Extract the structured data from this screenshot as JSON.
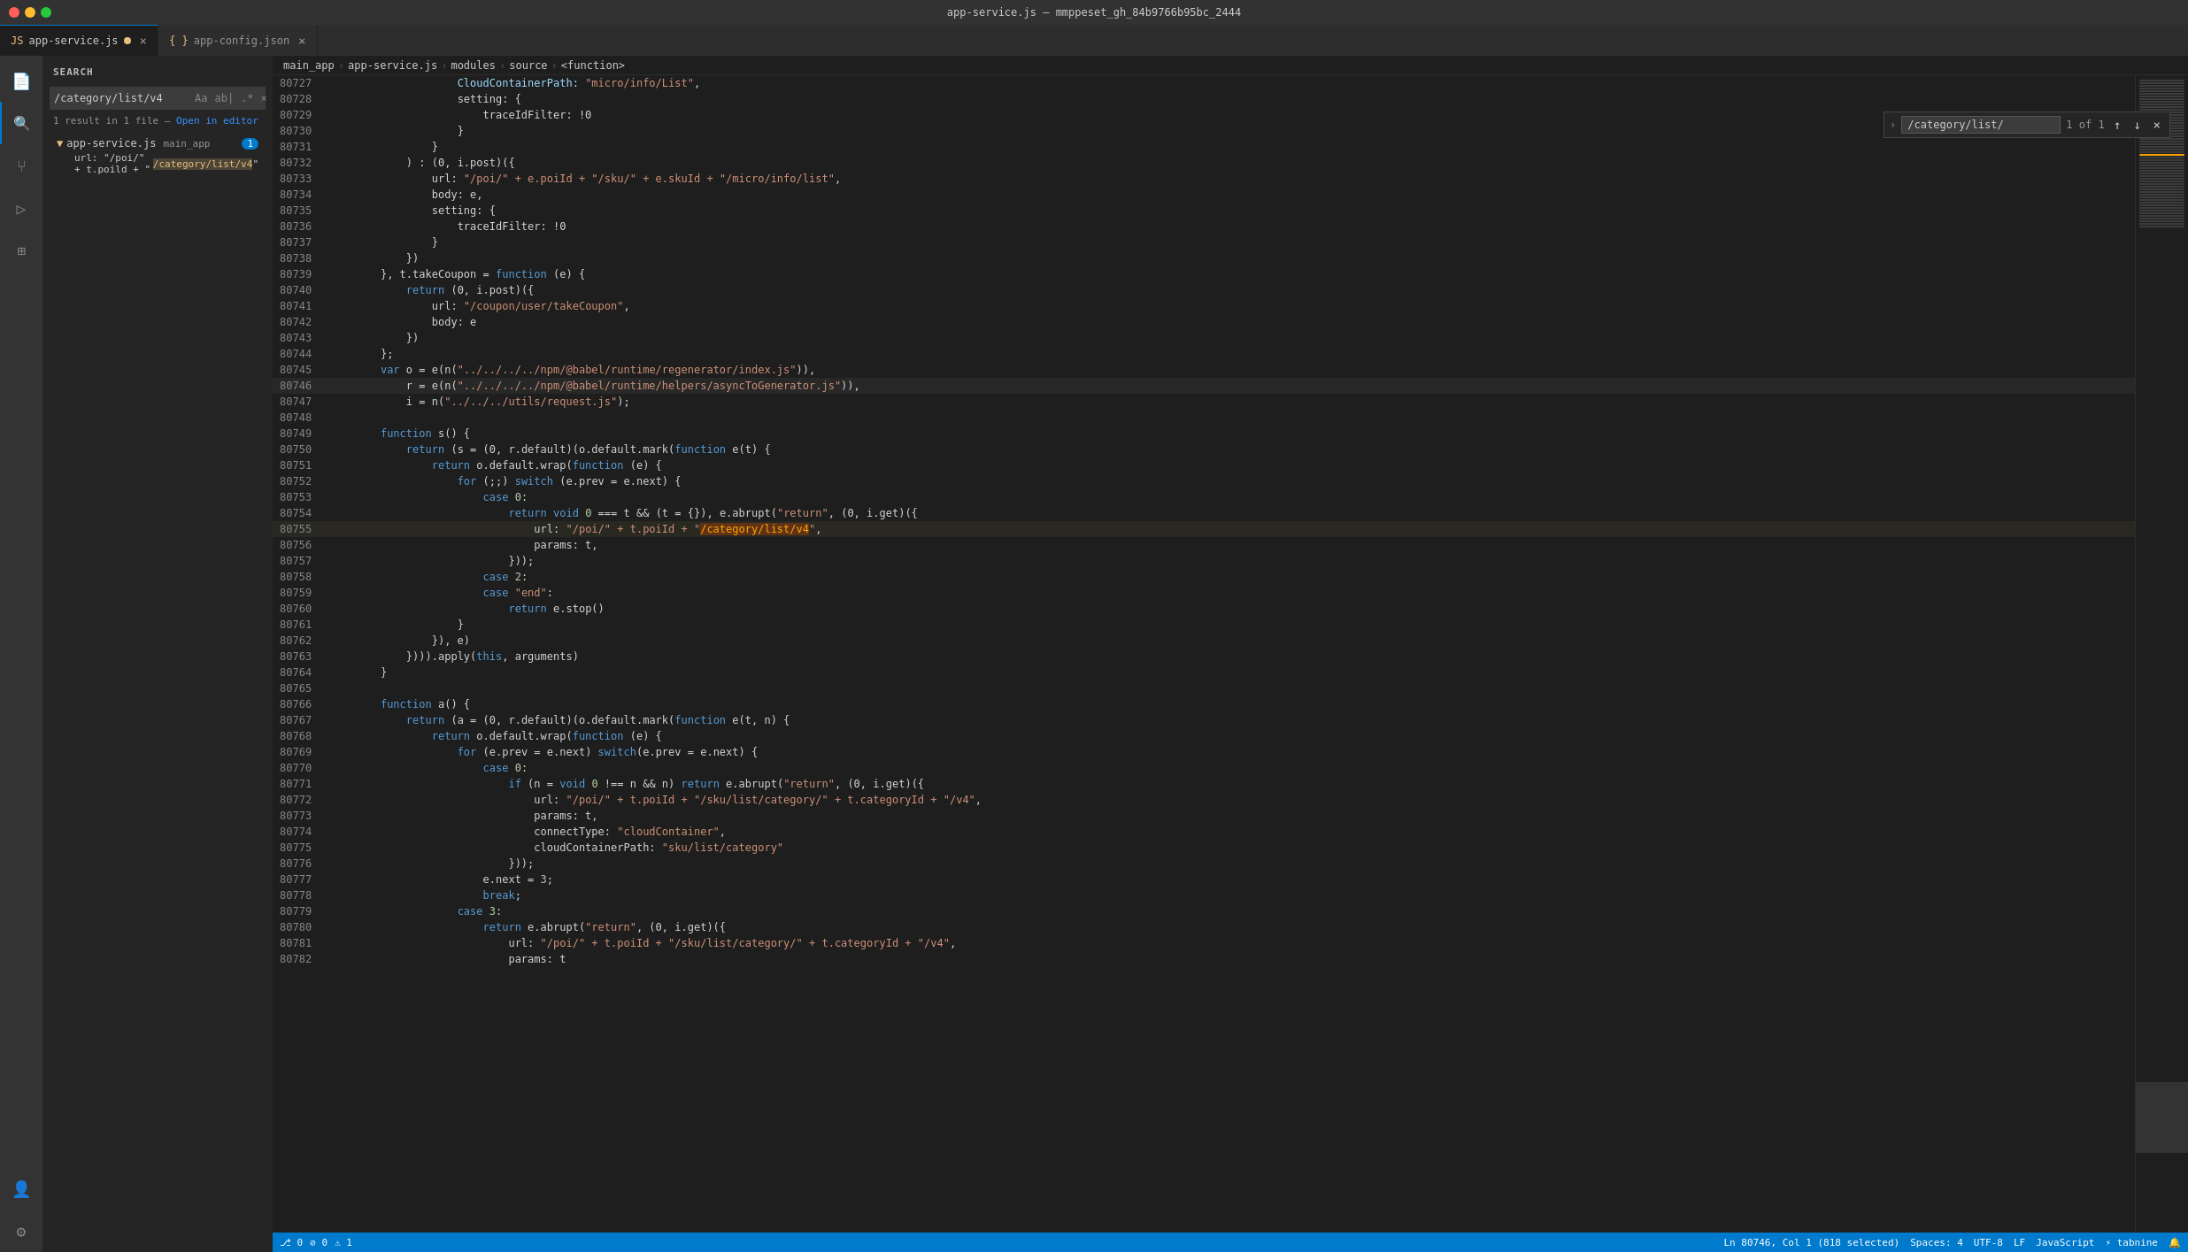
{
  "window": {
    "title": "app-service.js — mmppeset_gh_84b9766b95bc_2444"
  },
  "tabs": [
    {
      "id": "tab-app-service",
      "label": "app-service.js",
      "modified": true,
      "active": true,
      "icon": "js-icon"
    },
    {
      "id": "tab-app-config",
      "label": "app-config.json",
      "modified": false,
      "active": false,
      "icon": "json-icon"
    }
  ],
  "breadcrumb": {
    "items": [
      "main_app",
      "app-service.js",
      "modules",
      "source",
      "<function>"
    ]
  },
  "search": {
    "title": "SEARCH",
    "query": "/category/list/v4",
    "results_text": "1 result in 1 file",
    "open_in_editor": "Open in editor",
    "file": {
      "name": "app-service.js",
      "path": "main_app",
      "count": 1,
      "match_prefix": "url: \"/poi/\" + t.poild + \"",
      "match_text": "/category/list/v4",
      "match_suffix": "\""
    }
  },
  "find_widget": {
    "query": "/category/list/",
    "count": "1 of 1",
    "placeholder": ""
  },
  "code": {
    "lines": [
      {
        "num": "80727",
        "tokens": [
          {
            "t": "                    "
          },
          {
            "t": "CloudContainerPath: ",
            "c": "prop"
          },
          {
            "t": "\"micro/info/List\"",
            "c": "str"
          },
          {
            "t": ","
          }
        ]
      },
      {
        "num": "80728",
        "tokens": [
          {
            "t": "                    "
          },
          {
            "t": "setting"
          },
          {
            "t": ": {"
          }
        ]
      },
      {
        "num": "80729",
        "tokens": [
          {
            "t": "                        "
          },
          {
            "t": "traceIdFilter"
          },
          {
            "t": ": "
          },
          {
            "t": "!0"
          }
        ]
      },
      {
        "num": "80730",
        "tokens": [
          {
            "t": "                    "
          },
          {
            "t": "}"
          }
        ]
      },
      {
        "num": "80731",
        "tokens": [
          {
            "t": "                "
          },
          {
            "t": "}"
          }
        ]
      },
      {
        "num": "80732",
        "tokens": [
          {
            "t": "            "
          },
          {
            "t": ") : (0, i.post)({"
          }
        ]
      },
      {
        "num": "80733",
        "tokens": [
          {
            "t": "                "
          },
          {
            "t": "url"
          },
          {
            "t": ": "
          },
          {
            "t": "\"/poi/\" + e.poiId + \"/sku/\" + e.skuId + \"/micro/info/list\"",
            "c": "str"
          },
          {
            "t": ","
          }
        ]
      },
      {
        "num": "80734",
        "tokens": [
          {
            "t": "                "
          },
          {
            "t": "body"
          },
          {
            "t": ": e,"
          }
        ]
      },
      {
        "num": "80735",
        "tokens": [
          {
            "t": "                "
          },
          {
            "t": "setting"
          },
          {
            "t": ": {"
          }
        ]
      },
      {
        "num": "80736",
        "tokens": [
          {
            "t": "                    "
          },
          {
            "t": "traceIdFilter"
          },
          {
            "t": ": "
          },
          {
            "t": "!0"
          }
        ]
      },
      {
        "num": "80737",
        "tokens": [
          {
            "t": "                "
          },
          {
            "t": "}"
          }
        ]
      },
      {
        "num": "80738",
        "tokens": [
          {
            "t": "            "
          },
          {
            "t": "})"
          }
        ]
      },
      {
        "num": "80739",
        "tokens": [
          {
            "t": "        "
          },
          {
            "t": "}, t.takeCoupon = "
          },
          {
            "t": "function",
            "c": "kw"
          },
          {
            "t": " (e) {"
          }
        ]
      },
      {
        "num": "80740",
        "tokens": [
          {
            "t": "            "
          },
          {
            "t": "return",
            "c": "kw"
          },
          {
            "t": " (0, i.post)({"
          }
        ]
      },
      {
        "num": "80741",
        "tokens": [
          {
            "t": "                "
          },
          {
            "t": "url"
          },
          {
            "t": ": "
          },
          {
            "t": "\"/coupon/user/takeCoupon\"",
            "c": "str"
          },
          {
            "t": ","
          }
        ]
      },
      {
        "num": "80742",
        "tokens": [
          {
            "t": "                "
          },
          {
            "t": "body"
          },
          {
            "t": ": e"
          }
        ]
      },
      {
        "num": "80743",
        "tokens": [
          {
            "t": "            "
          },
          {
            "t": "})"
          }
        ]
      },
      {
        "num": "80744",
        "tokens": [
          {
            "t": "        "
          },
          {
            "t": "};"
          }
        ]
      },
      {
        "num": "80745",
        "tokens": [
          {
            "t": "        "
          },
          {
            "t": "var",
            "c": "kw"
          },
          {
            "t": " o = e(n("
          },
          {
            "t": "\"../../../../npm/@babel/runtime/regenerator/index.js\"",
            "c": "str"
          },
          {
            "t": ")),"
          }
        ]
      },
      {
        "num": "80746",
        "tokens": [
          {
            "t": "            "
          },
          {
            "t": "r = e(n("
          },
          {
            "t": "\"../../../../npm/@babel/runtime/helpers/asyncToGenerator.js\"",
            "c": "str"
          },
          {
            "t": ")),"
          }
        ]
      },
      {
        "num": "80747",
        "tokens": [
          {
            "t": "            "
          },
          {
            "t": "i = n("
          },
          {
            "t": "\"../../../utils/request.js\"",
            "c": "str"
          },
          {
            "t": ");"
          }
        ]
      },
      {
        "num": "80748",
        "tokens": [
          {
            "t": ""
          }
        ]
      },
      {
        "num": "80749",
        "tokens": [
          {
            "t": "        "
          },
          {
            "t": "function",
            "c": "kw"
          },
          {
            "t": " s() {"
          }
        ]
      },
      {
        "num": "80750",
        "tokens": [
          {
            "t": "            "
          },
          {
            "t": "return",
            "c": "kw"
          },
          {
            "t": " (s = (0, r.default)(o.default.mark("
          },
          {
            "t": "function",
            "c": "kw"
          },
          {
            "t": " e(t) {"
          }
        ]
      },
      {
        "num": "80751",
        "tokens": [
          {
            "t": "                "
          },
          {
            "t": "return",
            "c": "kw"
          },
          {
            "t": " o.default.wrap("
          },
          {
            "t": "function",
            "c": "kw"
          },
          {
            "t": " (e) {"
          }
        ]
      },
      {
        "num": "80752",
        "tokens": [
          {
            "t": "                    "
          },
          {
            "t": "for",
            "c": "kw"
          },
          {
            "t": " (;;) "
          },
          {
            "t": "switch",
            "c": "kw"
          },
          {
            "t": " (e.prev = e.next) {"
          }
        ]
      },
      {
        "num": "80753",
        "tokens": [
          {
            "t": "                        "
          },
          {
            "t": "case",
            "c": "kw"
          },
          {
            "t": " "
          },
          {
            "t": "0",
            "c": "num"
          },
          {
            "t": ":"
          }
        ]
      },
      {
        "num": "80754",
        "tokens": [
          {
            "t": "                            "
          },
          {
            "t": "return",
            "c": "kw"
          },
          {
            "t": " "
          },
          {
            "t": "void",
            "c": "kw"
          },
          {
            "t": " "
          },
          {
            "t": "0",
            "c": "num"
          },
          {
            "t": " === t && (t = {}), e.abrupt("
          },
          {
            "t": "\"return\"",
            "c": "str"
          },
          {
            "t": ", (0, i.get)({"
          }
        ]
      },
      {
        "num": "80755",
        "tokens": [
          {
            "t": "                                "
          },
          {
            "t": "url"
          },
          {
            "t": ": "
          },
          {
            "t": "\"/poi/\" + t.poiId + \"",
            "c": "str"
          },
          {
            "t": "/category/list/v4",
            "c": "hl-match"
          },
          {
            "t": "\"",
            "c": "str"
          },
          {
            "t": ","
          }
        ]
      },
      {
        "num": "80756",
        "tokens": [
          {
            "t": "                                "
          },
          {
            "t": "params"
          },
          {
            "t": ": t,"
          }
        ]
      },
      {
        "num": "80757",
        "tokens": [
          {
            "t": "                            "
          },
          {
            "t": "}));"
          }
        ]
      },
      {
        "num": "80758",
        "tokens": [
          {
            "t": "                        "
          },
          {
            "t": "case",
            "c": "kw"
          },
          {
            "t": " "
          },
          {
            "t": "2",
            "c": "num"
          },
          {
            "t": ":"
          }
        ]
      },
      {
        "num": "80759",
        "tokens": [
          {
            "t": "                        "
          },
          {
            "t": "case",
            "c": "kw"
          },
          {
            "t": " "
          },
          {
            "t": "\"end\"",
            "c": "str"
          },
          {
            "t": ":"
          }
        ]
      },
      {
        "num": "80760",
        "tokens": [
          {
            "t": "                            "
          },
          {
            "t": "return",
            "c": "kw"
          },
          {
            "t": " e.stop()"
          }
        ]
      },
      {
        "num": "80761",
        "tokens": [
          {
            "t": "                    "
          },
          {
            "t": "}"
          }
        ]
      },
      {
        "num": "80762",
        "tokens": [
          {
            "t": "                "
          },
          {
            "t": "}), e)"
          }
        ]
      },
      {
        "num": "80763",
        "tokens": [
          {
            "t": "            "
          },
          {
            "t": "})))"
          },
          {
            "t": ".apply(",
            "c": ""
          },
          {
            "t": "this",
            "c": "kw"
          },
          {
            "t": ", arguments)"
          }
        ]
      },
      {
        "num": "80764",
        "tokens": [
          {
            "t": "        "
          },
          {
            "t": "}"
          }
        ]
      },
      {
        "num": "80765",
        "tokens": [
          {
            "t": ""
          }
        ]
      },
      {
        "num": "80766",
        "tokens": [
          {
            "t": "        "
          },
          {
            "t": "function",
            "c": "kw"
          },
          {
            "t": " a() {"
          }
        ]
      },
      {
        "num": "80767",
        "tokens": [
          {
            "t": "            "
          },
          {
            "t": "return",
            "c": "kw"
          },
          {
            "t": " (a = (0, r.default)(o.default.mark("
          },
          {
            "t": "function",
            "c": "kw"
          },
          {
            "t": " e(t, n) {"
          }
        ]
      },
      {
        "num": "80768",
        "tokens": [
          {
            "t": "                "
          },
          {
            "t": "return",
            "c": "kw"
          },
          {
            "t": " o.default.wrap("
          },
          {
            "t": "function",
            "c": "kw"
          },
          {
            "t": " (e) {"
          }
        ]
      },
      {
        "num": "80769",
        "tokens": [
          {
            "t": "                    "
          },
          {
            "t": "for",
            "c": "kw"
          },
          {
            "t": " (e.prev = e.next) "
          },
          {
            "t": "switch",
            "c": "kw"
          },
          {
            "t": "(e.prev = e.next) {"
          }
        ]
      },
      {
        "num": "80770",
        "tokens": [
          {
            "t": "                        "
          },
          {
            "t": "case",
            "c": "kw"
          },
          {
            "t": " "
          },
          {
            "t": "0",
            "c": "num"
          },
          {
            "t": ":"
          }
        ]
      },
      {
        "num": "80771",
        "tokens": [
          {
            "t": "                            "
          },
          {
            "t": "if",
            "c": "kw"
          },
          {
            "t": " (n = "
          },
          {
            "t": "void",
            "c": "kw"
          },
          {
            "t": " "
          },
          {
            "t": "0",
            "c": "num"
          },
          {
            "t": " !== n && n) "
          },
          {
            "t": "return",
            "c": "kw"
          },
          {
            "t": " e.abrupt("
          },
          {
            "t": "\"return\"",
            "c": "str"
          },
          {
            "t": ", (0, i.get)({"
          }
        ]
      },
      {
        "num": "80772",
        "tokens": [
          {
            "t": "                                "
          },
          {
            "t": "url"
          },
          {
            "t": ": "
          },
          {
            "t": "\"/poi/\" + t.poiId + \"/sku/list/category/\" + t.categoryId + \"/v4\"",
            "c": "str"
          },
          {
            "t": ","
          }
        ]
      },
      {
        "num": "80773",
        "tokens": [
          {
            "t": "                                "
          },
          {
            "t": "params"
          },
          {
            "t": ": t,"
          }
        ]
      },
      {
        "num": "80774",
        "tokens": [
          {
            "t": "                                "
          },
          {
            "t": "connectType"
          },
          {
            "t": ": "
          },
          {
            "t": "\"cloudContainer\"",
            "c": "str"
          },
          {
            "t": ","
          }
        ]
      },
      {
        "num": "80775",
        "tokens": [
          {
            "t": "                                "
          },
          {
            "t": "cloudContainerPath"
          },
          {
            "t": ": "
          },
          {
            "t": "\"sku/list/category\"",
            "c": "str"
          }
        ]
      },
      {
        "num": "80776",
        "tokens": [
          {
            "t": "                            "
          },
          {
            "t": "}));"
          }
        ]
      },
      {
        "num": "80777",
        "tokens": [
          {
            "t": "                        "
          },
          {
            "t": "e.next = "
          },
          {
            "t": "3",
            "c": "num"
          },
          {
            "t": ";"
          }
        ]
      },
      {
        "num": "80778",
        "tokens": [
          {
            "t": "                        "
          },
          {
            "t": "break",
            "c": "kw"
          },
          {
            "t": ";"
          }
        ]
      },
      {
        "num": "80779",
        "tokens": [
          {
            "t": "                    "
          },
          {
            "t": "case",
            "c": "kw"
          },
          {
            "t": " "
          },
          {
            "t": "3",
            "c": "num"
          },
          {
            "t": ":"
          }
        ]
      },
      {
        "num": "80780",
        "tokens": [
          {
            "t": "                        "
          },
          {
            "t": "return",
            "c": "kw"
          },
          {
            "t": " e.abrupt("
          },
          {
            "t": "\"return\"",
            "c": "str"
          },
          {
            "t": ", (0, i.get)({"
          }
        ]
      },
      {
        "num": "80781",
        "tokens": [
          {
            "t": "                            "
          },
          {
            "t": "url"
          },
          {
            "t": ": "
          },
          {
            "t": "\"/poi/\" + t.poiId + \"/sku/list/category/\" + t.categoryId + \"/v4\"",
            "c": "str"
          },
          {
            "t": ","
          }
        ]
      },
      {
        "num": "80782",
        "tokens": [
          {
            "t": "                            "
          },
          {
            "t": "params"
          },
          {
            "t": ": t"
          }
        ]
      }
    ]
  },
  "status_bar": {
    "left": [
      {
        "id": "git-branch",
        "text": "⎇  0"
      },
      {
        "id": "errors",
        "text": "⊘ 0"
      },
      {
        "id": "warnings",
        "text": "⚠ 1"
      }
    ],
    "right": [
      {
        "id": "cursor-pos",
        "text": "Ln 80746, Col 1 (818 selected)"
      },
      {
        "id": "spaces",
        "text": "Spaces: 4"
      },
      {
        "id": "encoding",
        "text": "UTF-8"
      },
      {
        "id": "line-ending",
        "text": "LF"
      },
      {
        "id": "language",
        "text": "JavaScript"
      },
      {
        "id": "tabnine",
        "text": "⚡ tabnine"
      },
      {
        "id": "feedback",
        "text": "🔔"
      }
    ]
  },
  "activity_icons": [
    {
      "id": "explorer",
      "symbol": "⎘",
      "active": false
    },
    {
      "id": "search",
      "symbol": "🔍",
      "active": true
    },
    {
      "id": "source-control",
      "symbol": "⑂",
      "active": false
    },
    {
      "id": "run",
      "symbol": "▷",
      "active": false
    },
    {
      "id": "extensions",
      "symbol": "⊞",
      "active": false
    }
  ]
}
